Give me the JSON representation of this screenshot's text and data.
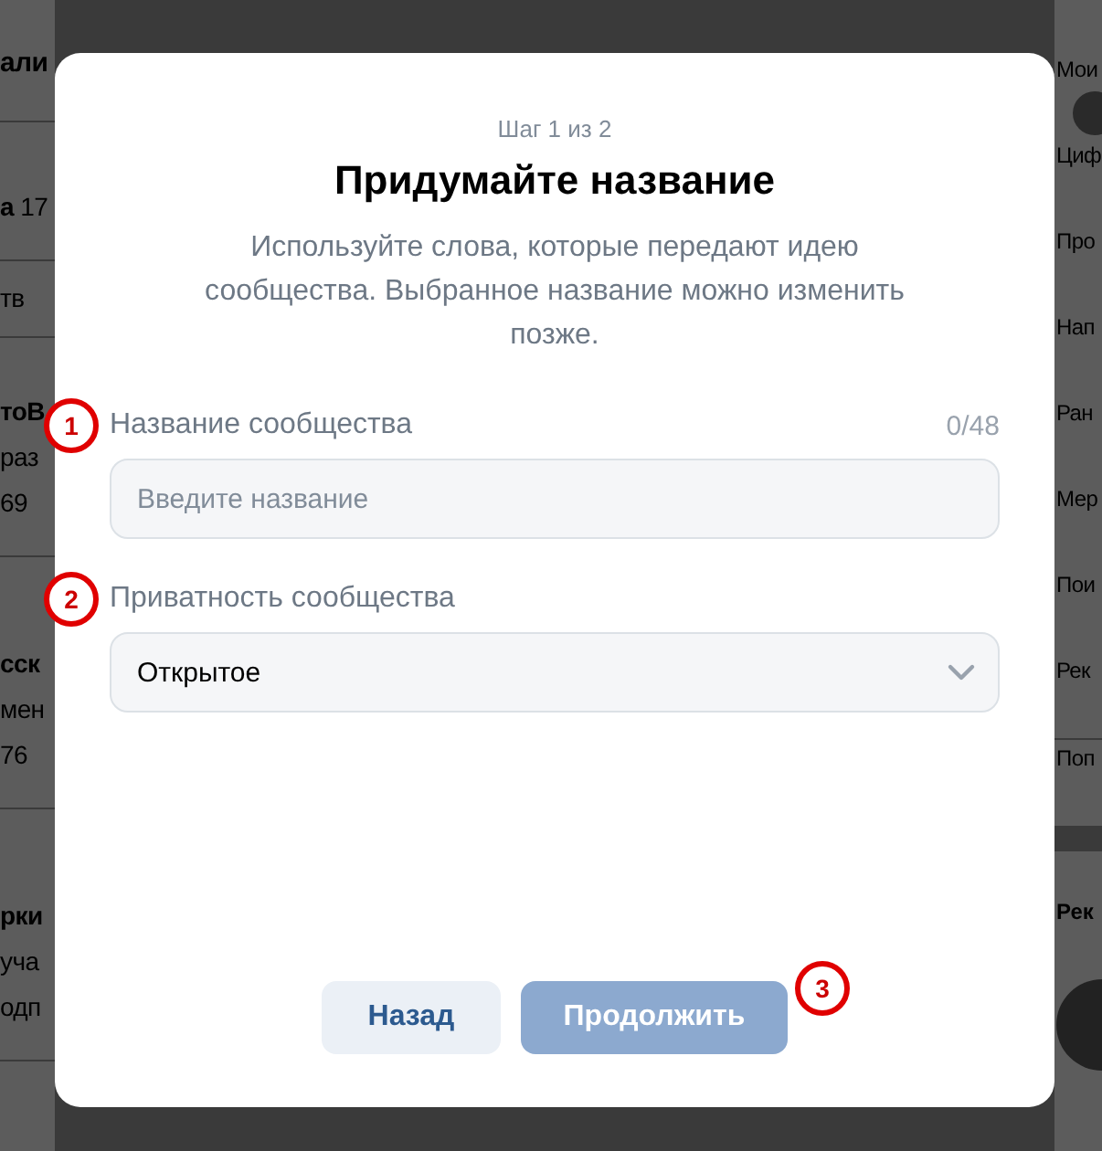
{
  "background": {
    "left_sections": [
      {
        "lines": [
          {
            "text": "али",
            "kind": "title"
          }
        ]
      },
      {
        "lines": [
          {
            "text": "**а** 17",
            "kind": "muted"
          }
        ]
      },
      {
        "lines": [
          {
            "text": "тв",
            "kind": "muted"
          }
        ]
      },
      {
        "lines": [
          {
            "text": "тоВ",
            "kind": "bold"
          },
          {
            "text": "раз",
            "kind": "text"
          },
          {
            "text": "69",
            "kind": "text"
          }
        ]
      },
      {
        "lines": [
          {
            "text": "сск",
            "kind": "bold"
          },
          {
            "text": "мен",
            "kind": "text"
          },
          {
            "text": "76",
            "kind": "text"
          }
        ]
      },
      {
        "lines": [
          {
            "text": "рки",
            "kind": "bold"
          },
          {
            "text": "уча",
            "kind": "text"
          },
          {
            "text": "одп",
            "kind": "text"
          }
        ]
      }
    ],
    "right_menu": [
      "Мои",
      "Циф",
      "Про",
      "Нап",
      "Ран",
      "Мер",
      "Пои",
      "Рек"
    ],
    "right_extra": "Поп",
    "right_card_title": "Рек"
  },
  "dialog": {
    "step": "Шаг 1 из 2",
    "title": "Придумайте название",
    "description": "Используйте слова, которые передают идею сообщества. Выбранное название можно изменить позже.",
    "name_field": {
      "marker": "1",
      "label": "Название сообщества",
      "counter": "0/48",
      "placeholder": "Введите название"
    },
    "privacy_field": {
      "marker": "2",
      "label": "Приватность сообщества",
      "value": "Открытое"
    },
    "back_button": {
      "label": "Назад"
    },
    "continue_button": {
      "label": "Продолжить",
      "disabled": true,
      "marker": "3"
    }
  }
}
